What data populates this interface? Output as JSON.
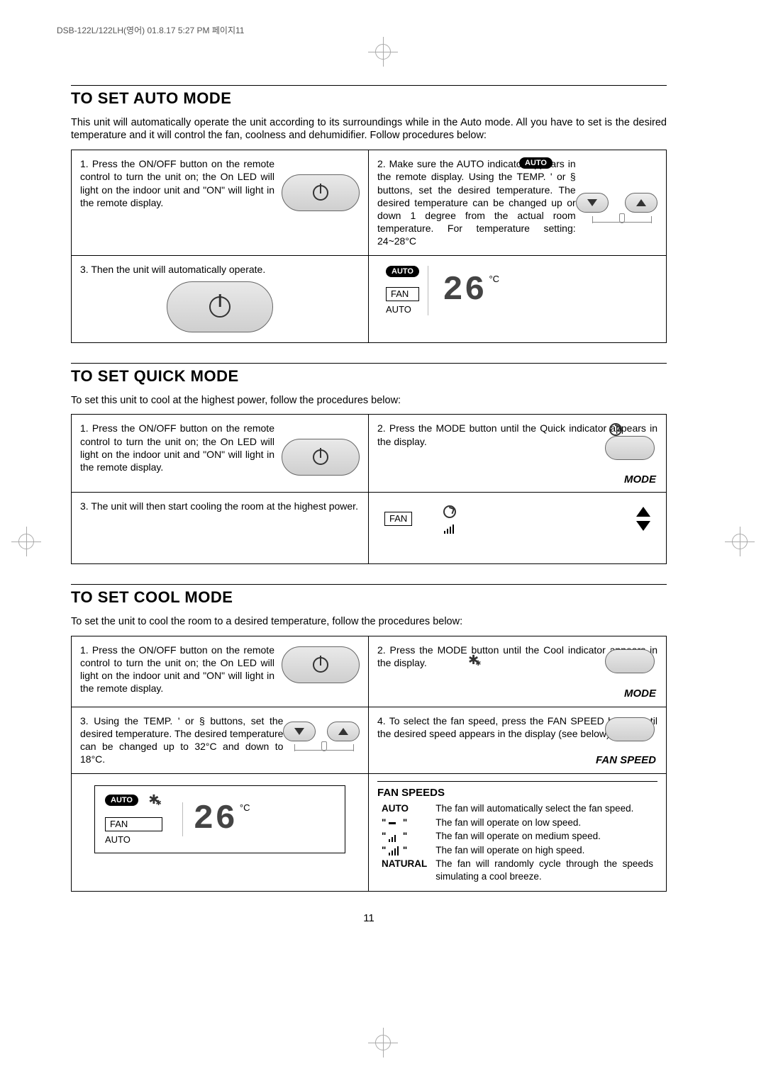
{
  "header_marker": "DSB-122L/122LH(영어)  01.8.17 5:27 PM  페이지11",
  "page_number": "11",
  "sections": {
    "auto": {
      "title": "TO SET AUTO MODE",
      "intro": "This unit will automatically operate the unit according to its surroundings while in the Auto mode. All you have to set is the desired temperature and it will control the fan, coolness and dehumidifier. Follow procedures below:",
      "step1": "1. Press the ON/OFF button on the remote control to turn the unit on; the On LED will light on the indoor unit and \"ON\" will light in the remote display.",
      "step2": "2. Make sure the AUTO indicator       appears in the remote display. Using the TEMP.  '  or  § buttons, set the desired temperature. The desired temperature can be changed up or down 1 degree from the actual room temperature. For temperature setting: 24~28°C",
      "step3": "3. Then the unit will automatically operate.",
      "auto_pill": "AUTO",
      "fan_label": "FAN",
      "auto_label": "AUTO",
      "temp_value": "26",
      "deg": "°C"
    },
    "quick": {
      "title": "TO SET QUICK MODE",
      "intro": "To set this unit to cool at the highest power, follow the procedures below:",
      "step1": "1. Press the ON/OFF button on the remote control to turn the unit on; the On LED will light on the indoor unit and \"ON\" will light in the remote display.",
      "step2": "2. Press the MODE button until the Quick indicator        appears in the display.",
      "step3": "3. The unit will then start cooling the room at the highest power.",
      "mode_label": "MODE",
      "fan_label": "FAN"
    },
    "cool": {
      "title": "TO SET COOL MODE",
      "intro": "To set the unit to cool the room to a desired temperature, follow the procedures below:",
      "step1": "1. Press the ON/OFF button on the remote control to turn the unit on; the On LED will light on the indoor unit and \"ON\" will light in the remote display.",
      "step2": "2. Press the MODE button until the Cool indicator        appears in the display.",
      "step3": "3. Using the TEMP.  '  or  §  buttons, set the desired temperature. The desired temperature can be changed up to 32°C and down to 18°C.",
      "step4": "4. To select the fan speed, press the FAN SPEED button until the desired speed appears in the display (see below).",
      "mode_label": "MODE",
      "fanspeed_label": "FAN SPEED",
      "auto_pill": "AUTO",
      "fan_label": "FAN",
      "auto_label": "AUTO",
      "temp_value": "26",
      "deg": "°C",
      "fanspeeds_title": "FAN SPEEDS",
      "fs": {
        "r1a": "AUTO",
        "r1b": "The fan will automatically select the fan speed.",
        "r2a": "\"    \"",
        "r2b": "The fan will operate on low speed.",
        "r3a": "\"    \"",
        "r3b": "The fan will operate on medium speed.",
        "r4a": "\"    \"",
        "r4b": "The fan will operate on high speed.",
        "r5a": "NATURAL",
        "r5b": "The fan will randomly cycle through the speeds simulating a cool breeze."
      }
    }
  }
}
